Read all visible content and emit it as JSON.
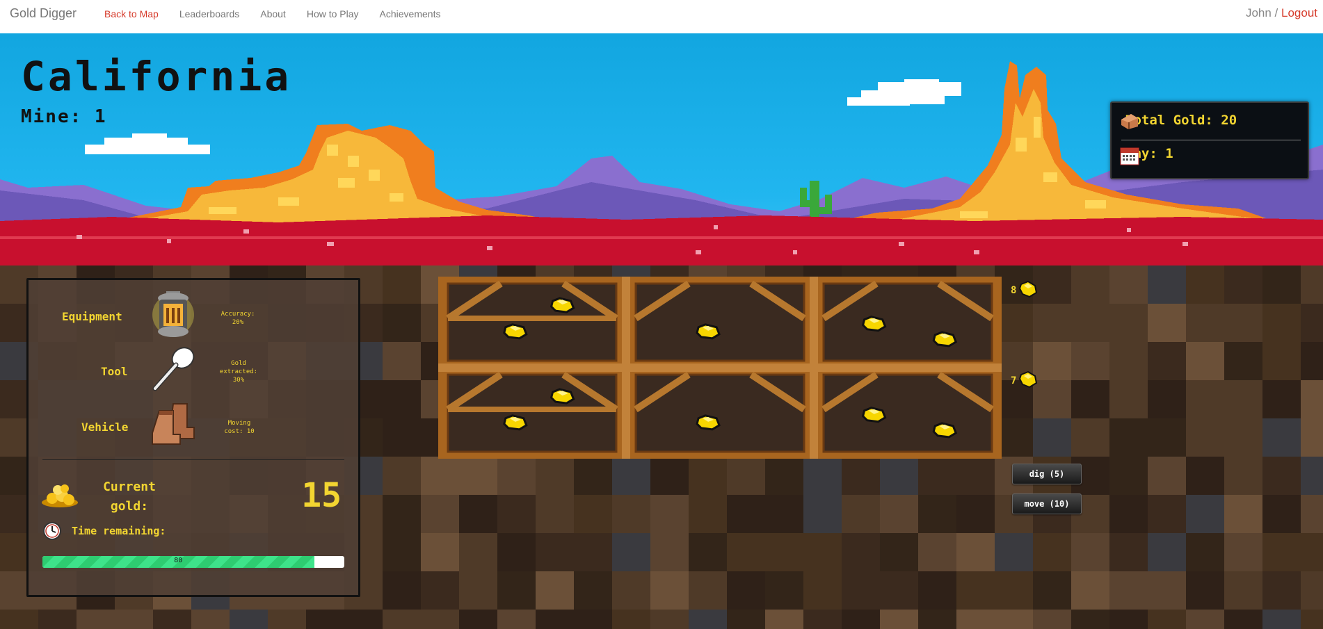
{
  "nav": {
    "brand": "Gold Digger",
    "links": [
      "Back to Map",
      "Leaderboards",
      "About",
      "How to Play",
      "Achievements"
    ],
    "user": "John",
    "separator": " / ",
    "logout": "Logout"
  },
  "hero": {
    "region": "California",
    "mine_label": "Mine: 1",
    "total_gold": "Total Gold: 20",
    "day": "Day: 1"
  },
  "panel": {
    "equipment": {
      "label": "Equipment",
      "desc_1": "Accuracy:",
      "desc_2": "20%",
      "icon": "lantern-icon"
    },
    "tool": {
      "label": "Tool",
      "desc_1": "Gold",
      "desc_2": "extracted:",
      "desc_3": "30%",
      "icon": "spoon-icon"
    },
    "vehicle": {
      "label": "Vehicle",
      "desc_1": "Moving",
      "desc_2": "cost: 10",
      "icon": "boots-icon"
    },
    "current_gold_label_1": "Current",
    "current_gold_label_2": "gold:",
    "current_gold": "15",
    "time_label": "Time remaining:",
    "time_remaining": "80",
    "time_fraction": 0.9
  },
  "mine": {
    "row_counts": [
      "8",
      "7"
    ],
    "dig_button": "dig (5)",
    "move_button": "move (10)"
  },
  "colors": {
    "gold_text": "#f2d531",
    "sky": "#21b6ef",
    "ground_red": "#c8102e",
    "accent_red": "#d63b2b"
  }
}
